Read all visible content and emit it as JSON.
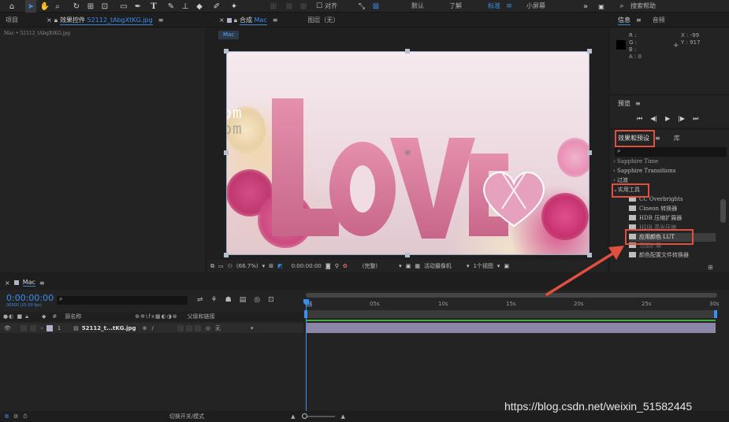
{
  "toolbar": {
    "snap_label": "对齐",
    "workspaces": [
      "默认",
      "了解",
      "标准",
      "小屏幕"
    ],
    "active_workspace": "标准",
    "search_placeholder": "搜索帮助"
  },
  "project_panel": {
    "tab_project": "项目",
    "tab_effects_controls": "效果控件",
    "effects_target": "52112_tAbgXtKG.jpg",
    "breadcrumb": "Mac • 52112_tAbgXtKG.jpg"
  },
  "composition_panel": {
    "tab_label": "合成",
    "comp_name": "Mac",
    "layer_tab": "图层（无）",
    "comp_chip": "Mac",
    "watermark_top": "Macv.com",
    "watermark_bottom": "Macv.com",
    "zoom": "(66.7%)",
    "timecode": "0:00:00:00",
    "quality": "(完整)",
    "camera": "活动摄像机",
    "views": "1个视图"
  },
  "info_panel": {
    "tab_info": "信息",
    "tab_audio": "音频",
    "r": "R :",
    "g": "G :",
    "b": "B :",
    "a": "A : 0",
    "x": "X : -99",
    "y": "Y : 917"
  },
  "preview_panel": {
    "tab_label": "预览"
  },
  "effects_panel": {
    "tab_effects": "效果和预设",
    "tab_library": "库",
    "items": [
      {
        "label": "Sapphire Time",
        "type": "category"
      },
      {
        "label": "Sapphire Transitions",
        "type": "category"
      },
      {
        "label": "过渡",
        "type": "category"
      },
      {
        "label": "实用工具",
        "type": "category-open"
      },
      {
        "label": "CC Overbrights",
        "type": "effect"
      },
      {
        "label": "Cineon 转换器",
        "type": "effect"
      },
      {
        "label": "HDR 压缩扩展器",
        "type": "effect"
      },
      {
        "label": "HDR 高光压缩",
        "type": "effect"
      },
      {
        "label": "应用颜色 LUT",
        "type": "effect-highlight"
      },
      {
        "label": "范围扩展",
        "type": "effect"
      },
      {
        "label": "颜色配置文件转换器",
        "type": "effect"
      }
    ]
  },
  "timeline": {
    "tab_label": "Mac",
    "timecode": "0:00:00:00",
    "fps_info": "00000 (25.00 fps)",
    "col_source_name": "源名称",
    "col_parent": "父级和链接",
    "ruler": [
      "0s",
      "05s",
      "10s",
      "15s",
      "20s",
      "25s",
      "30s"
    ],
    "layer": {
      "index": "1",
      "name": "52112_t...tKG.jpg",
      "parent": "无"
    },
    "footer_toggle": "切换开关/模式"
  },
  "watermark_url": "https://blog.csdn.net/weixin_51582445",
  "colors": {
    "accent_blue": "#3b8eea",
    "annotation_red": "#e0503f",
    "time_green": "#3fae3f",
    "layer_bar": "#8b86a8"
  }
}
